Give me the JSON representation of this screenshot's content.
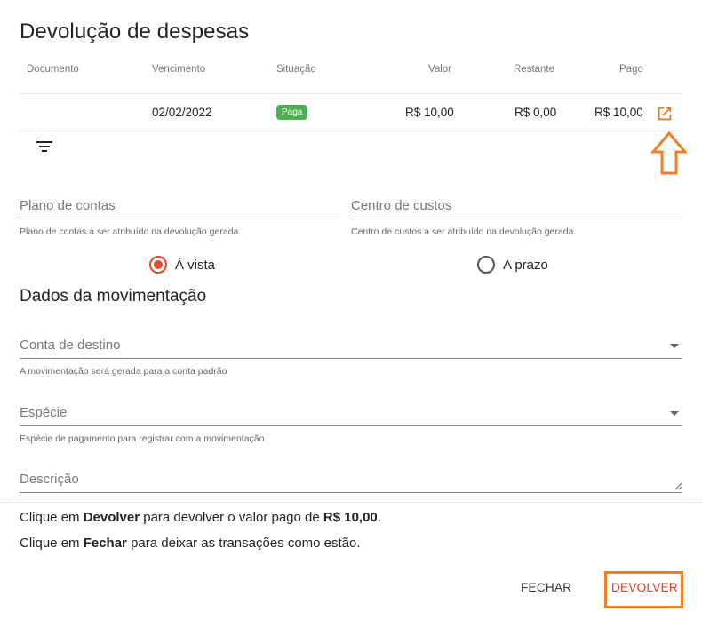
{
  "dialog": {
    "title": "Devolução de despesas"
  },
  "table": {
    "columns": [
      "Documento",
      "Vencimento",
      "Situação",
      "Valor",
      "Restante",
      "Pago"
    ],
    "rows": [
      {
        "documento": "",
        "vencimento": "02/02/2022",
        "situacao": "Paga",
        "valor": "R$ 10,00",
        "restante": "R$ 0,00",
        "pago": "R$ 10,00"
      }
    ]
  },
  "fields": {
    "plano": {
      "label": "Plano de contas",
      "hint": "Plano de contas a ser atribuído na devolução gerada."
    },
    "centro": {
      "label": "Centro de custos",
      "hint": "Centro de custos a ser atribuído na devolução gerada."
    }
  },
  "payment": {
    "options": [
      {
        "label": "À vista",
        "selected": true
      },
      {
        "label": "A prazo",
        "selected": false
      }
    ]
  },
  "movimentacao": {
    "title": "Dados da movimentação",
    "conta": {
      "label": "Conta de destino",
      "hint": "A movimentação será gerada para a conta padrão"
    },
    "especie": {
      "label": "Espécie",
      "hint": "Espécie de pagamento para registrar com a movimentação"
    },
    "descricao": {
      "label": "Descrição"
    }
  },
  "footer": {
    "line1": {
      "pre": "Clique em ",
      "bold1": "Devolver",
      "mid": " para devolver o valor pago de ",
      "bold2": "R$ 10,00",
      "post": "."
    },
    "line2": {
      "pre": "Clique em ",
      "bold1": "Fechar",
      "post": " para deixar as transações como estão."
    },
    "fechar_label": "FECHAR",
    "devolver_label": "DEVOLVER"
  },
  "colors": {
    "status_paid": "#4caf50",
    "accent": "#e44a2a",
    "annotation": "#f07f24"
  },
  "icons": [
    "open-in-new-icon",
    "filter-icon",
    "dropdown-arrow-icon",
    "resize-handle-icon"
  ]
}
